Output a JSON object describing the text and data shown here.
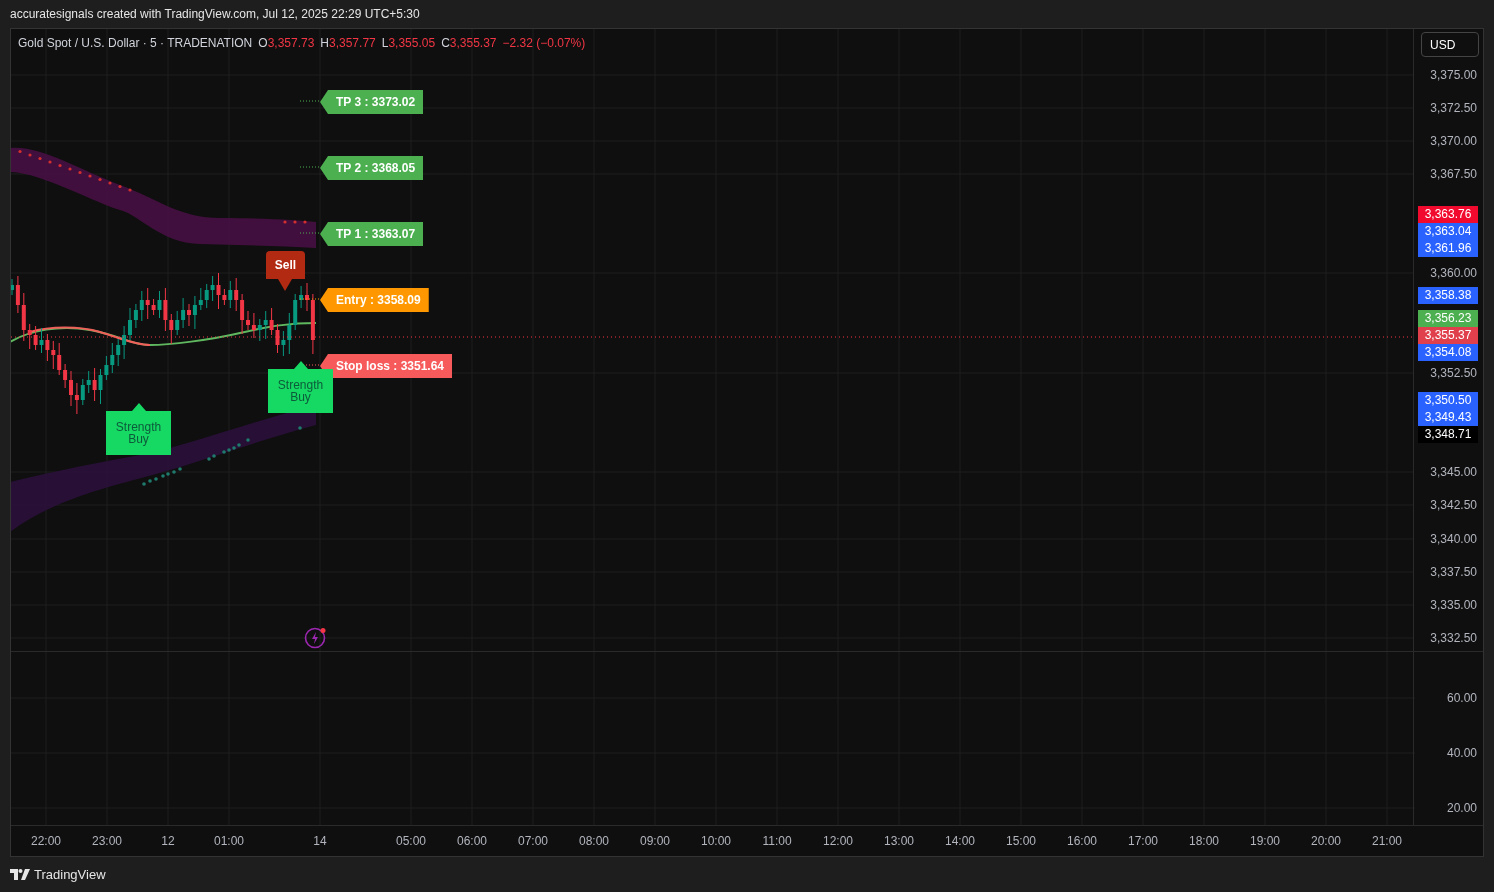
{
  "snapshot_header": "accuratesignals created with TradingView.com, Jul 12, 2025 22:29 UTC+5:30",
  "legend": {
    "symbol": "Gold Spot / U.S. Dollar · 5 · TRADENATION",
    "ohlc": [
      {
        "label": "O",
        "value": "3,357.73"
      },
      {
        "label": "H",
        "value": "3,357.77"
      },
      {
        "label": "L",
        "value": "3,355.05"
      },
      {
        "label": "C",
        "value": "3,355.37"
      }
    ],
    "change": "−2.32 (−0.07%)"
  },
  "currency_button": "USD",
  "signals": [
    {
      "text": "TP 3 : 3373.02",
      "color": "#4caf50"
    },
    {
      "text": "TP 2 : 3368.05",
      "color": "#4caf50"
    },
    {
      "text": "TP 1 : 3363.07",
      "color": "#4caf50"
    },
    {
      "text": "Entry : 3358.09",
      "color": "#ff9800"
    },
    {
      "text": "Stop loss : 3351.64",
      "color": "#f65a5a"
    }
  ],
  "markers": [
    {
      "kind": "sell",
      "text": "Sell"
    },
    {
      "kind": "buy",
      "text": "Strength Buy"
    },
    {
      "kind": "buy",
      "text": "Strength Buy"
    }
  ],
  "price_axis": {
    "ticks": [
      "3,375.00",
      "3,372.50",
      "3,370.00",
      "3,367.50",
      "3,360.00",
      "3,352.50",
      "3,345.00",
      "3,342.50",
      "3,340.00",
      "3,337.50",
      "3,335.00",
      "3,332.50"
    ],
    "badges": [
      {
        "value": "3,363.76",
        "color": "#f20a2e"
      },
      {
        "value": "3,363.04",
        "color": "#2962ff"
      },
      {
        "value": "3,361.96",
        "color": "#2962ff"
      },
      {
        "value": "3,358.38",
        "color": "#2962ff"
      },
      {
        "value": "3,356.23",
        "color": "#4caf50"
      },
      {
        "value": "3,355.37",
        "color": "#e0404c"
      },
      {
        "value": "3,354.08",
        "color": "#2962ff"
      },
      {
        "value": "3,350.50",
        "color": "#2962ff"
      },
      {
        "value": "3,349.43",
        "color": "#2962ff"
      },
      {
        "value": "3,348.71",
        "color": "#000000"
      }
    ]
  },
  "lower_axis": {
    "ticks": [
      "60.00",
      "40.00",
      "20.00"
    ]
  },
  "time_axis": {
    "labels": [
      "22:00",
      "23:00",
      "12",
      "01:00",
      "14",
      "05:00",
      "06:00",
      "07:00",
      "08:00",
      "09:00",
      "10:00",
      "11:00",
      "12:00",
      "13:00",
      "14:00",
      "15:00",
      "16:00",
      "17:00",
      "18:00",
      "19:00",
      "20:00",
      "21:00"
    ]
  },
  "footer": {
    "brand": "TradingView"
  }
}
